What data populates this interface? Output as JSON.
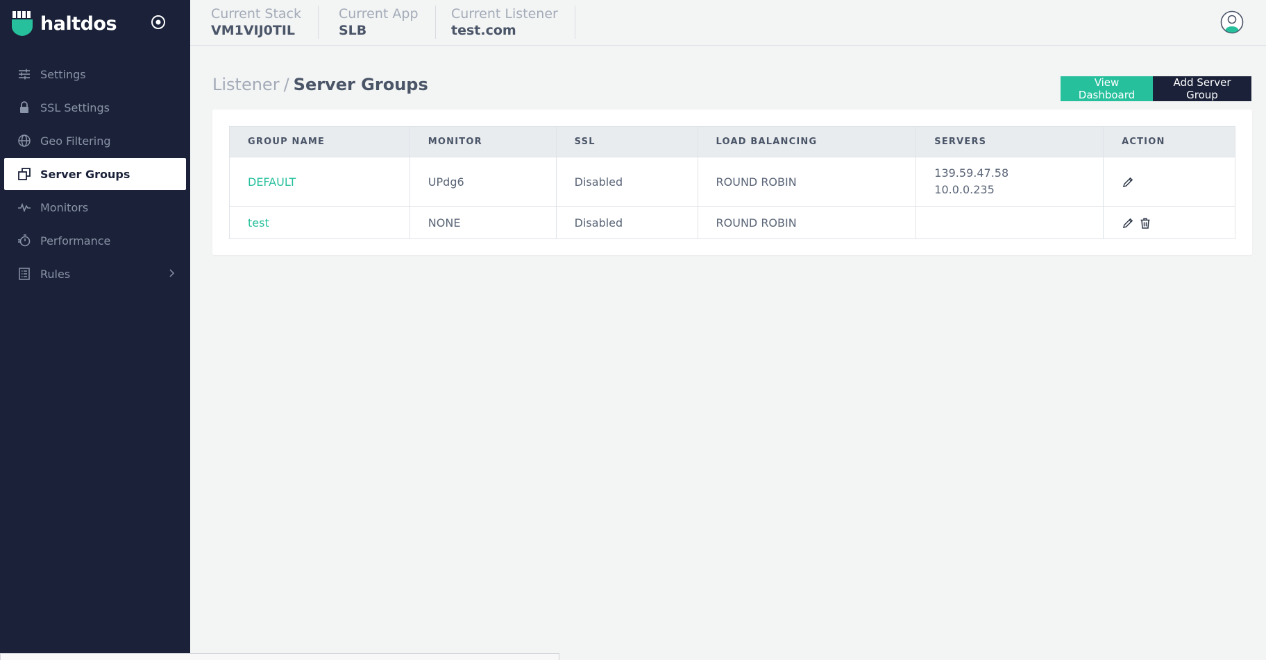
{
  "brand": {
    "name": "haltdos"
  },
  "colors": {
    "accent": "#27c09d",
    "sidebar_bg": "#1a2138",
    "page_bg": "#f3f4f4"
  },
  "sidebar": {
    "items": [
      {
        "label": "Settings",
        "icon": "sliders-icon"
      },
      {
        "label": "SSL Settings",
        "icon": "lock-icon"
      },
      {
        "label": "Geo Filtering",
        "icon": "globe-icon"
      },
      {
        "label": "Server Groups",
        "icon": "server-groups-icon",
        "active": true
      },
      {
        "label": "Monitors",
        "icon": "pulse-icon"
      },
      {
        "label": "Performance",
        "icon": "stopwatch-icon"
      },
      {
        "label": "Rules",
        "icon": "list-icon",
        "has_submenu": true
      }
    ]
  },
  "header": {
    "stack_label": "Current Stack",
    "stack_value": "VM1VIJ0TIL",
    "app_label": "Current App",
    "app_value": "SLB",
    "listener_label": "Current Listener",
    "listener_value": "test.com"
  },
  "breadcrumb": {
    "parent": "Listener",
    "separator": "/",
    "current": "Server Groups"
  },
  "actions": {
    "view_dashboard": "View Dashboard",
    "add_server_group": "Add Server Group"
  },
  "table": {
    "headers": [
      "GROUP NAME",
      "MONITOR",
      "SSL",
      "LOAD BALANCING",
      "SERVERS",
      "ACTION"
    ],
    "rows": [
      {
        "group_name": "DEFAULT",
        "monitor": "UPdg6",
        "ssl": "Disabled",
        "load_balancing": "ROUND ROBIN",
        "servers": [
          "139.59.47.58",
          "10.0.0.235"
        ],
        "actions": [
          "edit-icon"
        ]
      },
      {
        "group_name": "test",
        "monitor": "NONE",
        "ssl": "Disabled",
        "load_balancing": "ROUND ROBIN",
        "servers": [],
        "actions": [
          "edit-icon",
          "trash-icon"
        ]
      }
    ]
  }
}
